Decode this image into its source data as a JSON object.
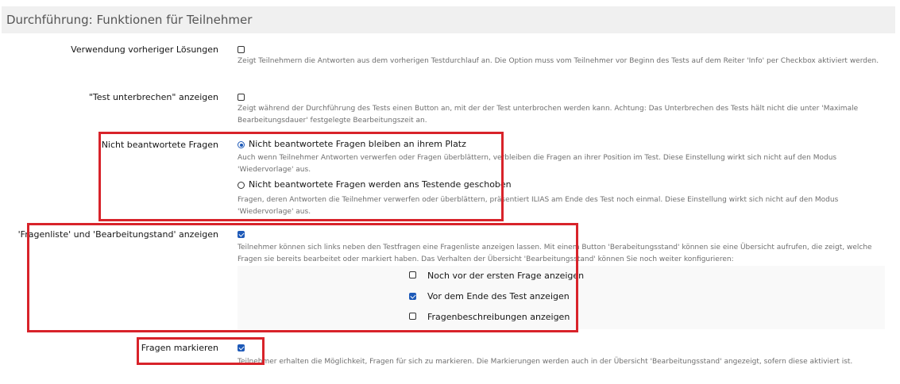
{
  "section": {
    "title": "Durchführung: Funktionen für Teilnehmer"
  },
  "settings": {
    "previous_solutions": {
      "label": "Verwendung vorheriger Lösungen",
      "checked": false,
      "description": "Zeigt Teilnehmern die Antworten aus dem vorherigen Testdurchlauf an. Die Option muss vom Teilnehmer vor Beginn des Tests auf dem Reiter 'Info' per Checkbox aktiviert werden."
    },
    "suspend_test": {
      "label": "\"Test unterbrechen\" anzeigen",
      "checked": false,
      "description": "Zeigt während der Durchführung des Tests einen Button an, mit der der Test unterbrochen werden kann. Achtung: Das Unterbrechen des Tests hält nicht die unter 'Maximale Bearbeitungsdauer' festgelegte Bearbeitungszeit an."
    },
    "unanswered": {
      "label": "Nicht beantwortete Fragen",
      "options": [
        {
          "label": "Nicht beantwortete Fragen bleiben an ihrem Platz",
          "selected": true,
          "description": "Auch wenn Teilnehmer Antworten verwerfen oder Fragen überblättern, verbleiben die Fragen an ihrer Position im Test. Diese Einstellung wirkt sich nicht auf den Modus 'Wiedervorlage' aus."
        },
        {
          "label": "Nicht beantwortete Fragen werden ans Testende geschoben",
          "selected": false,
          "description": "Fragen, deren Antworten die Teilnehmer verwerfen oder überblättern, präsentiert ILIAS am Ende des Test noch einmal. Diese Einstellung wirkt sich nicht auf den Modus 'Wiedervorlage' aus."
        }
      ]
    },
    "question_list": {
      "label": "'Fragenliste' und 'Bearbeitungstand' anzeigen",
      "checked": true,
      "description": "Teilnehmer können sich links neben den Testfragen eine Fragenliste anzeigen lassen. Mit einem Button 'Berabeitungsstand' können sie eine Übersicht aufrufen, die zeigt, welche Fragen sie bereits bearbeitet oder markiert haben. Das Verhalten der Übersicht 'Bearbeitungsstand' können Sie noch weiter konfigurieren:",
      "sub_options": [
        {
          "label": "Noch vor der ersten Frage anzeigen",
          "checked": false
        },
        {
          "label": "Vor dem Ende des Test anzeigen",
          "checked": true
        },
        {
          "label": "Fragenbeschreibungen anzeigen",
          "checked": false
        }
      ]
    },
    "mark_questions": {
      "label": "Fragen markieren",
      "checked": true,
      "description": "Teilnehmer erhalten die Möglichkeit, Fragen für sich zu markieren. Die Markierungen werden auch in der Übersicht 'Bearbeitungsstand' angezeigt, sofern diese aktiviert ist."
    }
  },
  "colors": {
    "highlight": "#d8232a",
    "accent": "#1e5ab8"
  }
}
